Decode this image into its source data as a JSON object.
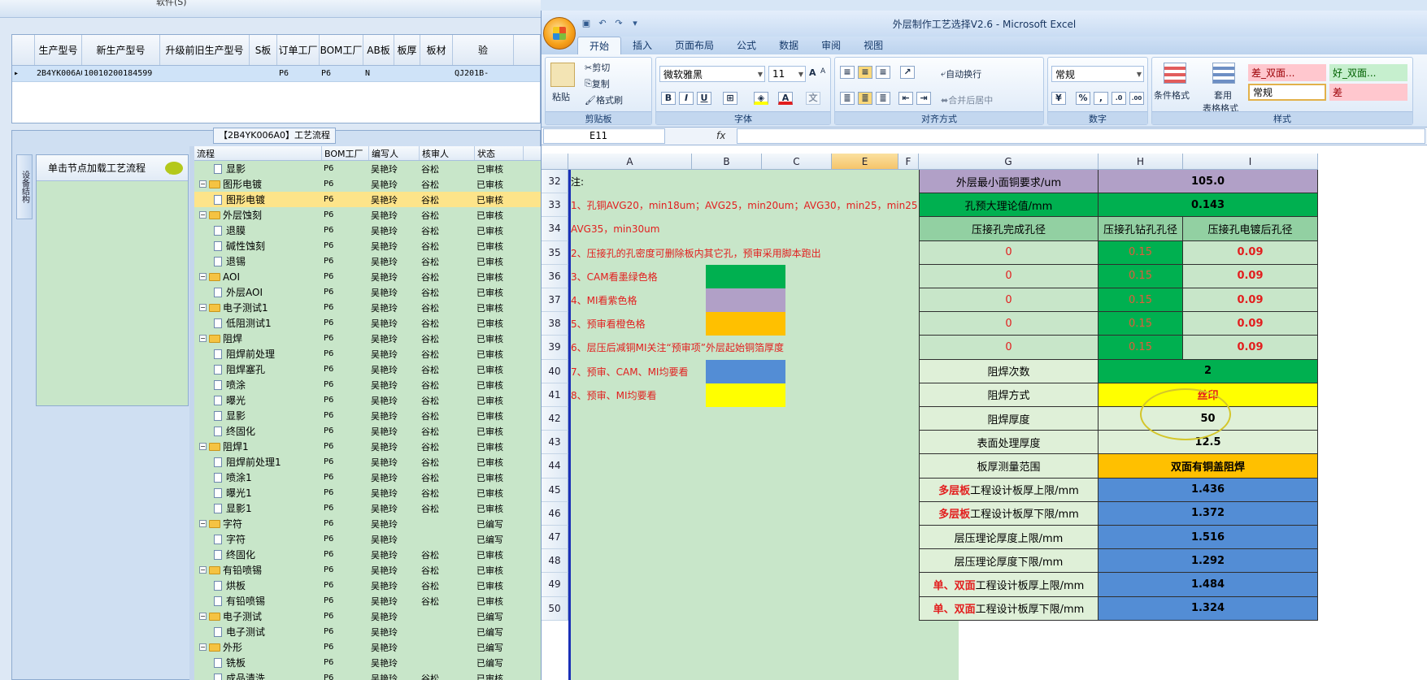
{
  "left_app": {
    "top_label": "软件(S)",
    "grid": {
      "columns": [
        "生产型号",
        "新生产型号",
        "升级前旧生产型号",
        "S板",
        "订单工厂",
        "BOM工厂",
        "AB板",
        "板厚",
        "板材",
        "验"
      ],
      "row": [
        "2B4YK006A0",
        "10010200184599",
        "",
        "",
        "P6",
        "P6",
        "N",
        "",
        "",
        "QJ201B-"
      ]
    },
    "flow_title": "【2B4YK006A0】工艺流程",
    "side_tab": "设备结构",
    "hint": "单击节点加载工艺流程",
    "tree_columns": [
      "流程",
      "BOM工厂",
      "编写人",
      "核审人",
      "状态"
    ],
    "tree_rows": [
      {
        "level": 2,
        "name": "显影",
        "bom": "P6",
        "writer": "吴艳玲",
        "reviewer": "谷松",
        "status": "已审核"
      },
      {
        "level": 1,
        "name": "图形电镀",
        "bom": "P6",
        "writer": "吴艳玲",
        "reviewer": "谷松",
        "status": "已审核"
      },
      {
        "level": 2,
        "name": "图形电镀",
        "bom": "P6",
        "writer": "吴艳玲",
        "reviewer": "谷松",
        "status": "已审核",
        "selected": true
      },
      {
        "level": 1,
        "name": "外层蚀刻",
        "bom": "P6",
        "writer": "吴艳玲",
        "reviewer": "谷松",
        "status": "已审核"
      },
      {
        "level": 2,
        "name": "退膜",
        "bom": "P6",
        "writer": "吴艳玲",
        "reviewer": "谷松",
        "status": "已审核"
      },
      {
        "level": 2,
        "name": "碱性蚀刻",
        "bom": "P6",
        "writer": "吴艳玲",
        "reviewer": "谷松",
        "status": "已审核"
      },
      {
        "level": 2,
        "name": "退锡",
        "bom": "P6",
        "writer": "吴艳玲",
        "reviewer": "谷松",
        "status": "已审核"
      },
      {
        "level": 1,
        "name": "AOI",
        "bom": "P6",
        "writer": "吴艳玲",
        "reviewer": "谷松",
        "status": "已审核"
      },
      {
        "level": 2,
        "name": "外层AOI",
        "bom": "P6",
        "writer": "吴艳玲",
        "reviewer": "谷松",
        "status": "已审核"
      },
      {
        "level": 1,
        "name": "电子测试1",
        "bom": "P6",
        "writer": "吴艳玲",
        "reviewer": "谷松",
        "status": "已审核"
      },
      {
        "level": 2,
        "name": "低阻测试1",
        "bom": "P6",
        "writer": "吴艳玲",
        "reviewer": "谷松",
        "status": "已审核"
      },
      {
        "level": 1,
        "name": "阻焊",
        "bom": "P6",
        "writer": "吴艳玲",
        "reviewer": "谷松",
        "status": "已审核"
      },
      {
        "level": 2,
        "name": "阻焊前处理",
        "bom": "P6",
        "writer": "吴艳玲",
        "reviewer": "谷松",
        "status": "已审核"
      },
      {
        "level": 2,
        "name": "阻焊塞孔",
        "bom": "P6",
        "writer": "吴艳玲",
        "reviewer": "谷松",
        "status": "已审核"
      },
      {
        "level": 2,
        "name": "喷涂",
        "bom": "P6",
        "writer": "吴艳玲",
        "reviewer": "谷松",
        "status": "已审核"
      },
      {
        "level": 2,
        "name": "曝光",
        "bom": "P6",
        "writer": "吴艳玲",
        "reviewer": "谷松",
        "status": "已审核"
      },
      {
        "level": 2,
        "name": "显影",
        "bom": "P6",
        "writer": "吴艳玲",
        "reviewer": "谷松",
        "status": "已审核"
      },
      {
        "level": 2,
        "name": "终固化",
        "bom": "P6",
        "writer": "吴艳玲",
        "reviewer": "谷松",
        "status": "已审核"
      },
      {
        "level": 1,
        "name": "阻焊1",
        "bom": "P6",
        "writer": "吴艳玲",
        "reviewer": "谷松",
        "status": "已审核"
      },
      {
        "level": 2,
        "name": "阻焊前处理1",
        "bom": "P6",
        "writer": "吴艳玲",
        "reviewer": "谷松",
        "status": "已审核"
      },
      {
        "level": 2,
        "name": "喷涂1",
        "bom": "P6",
        "writer": "吴艳玲",
        "reviewer": "谷松",
        "status": "已审核"
      },
      {
        "level": 2,
        "name": "曝光1",
        "bom": "P6",
        "writer": "吴艳玲",
        "reviewer": "谷松",
        "status": "已审核"
      },
      {
        "level": 2,
        "name": "显影1",
        "bom": "P6",
        "writer": "吴艳玲",
        "reviewer": "谷松",
        "status": "已审核"
      },
      {
        "level": 1,
        "name": "字符",
        "bom": "P6",
        "writer": "吴艳玲",
        "reviewer": "",
        "status": "已编写"
      },
      {
        "level": 2,
        "name": "字符",
        "bom": "P6",
        "writer": "吴艳玲",
        "reviewer": "",
        "status": "已编写"
      },
      {
        "level": 2,
        "name": "终固化",
        "bom": "P6",
        "writer": "吴艳玲",
        "reviewer": "谷松",
        "status": "已审核"
      },
      {
        "level": 1,
        "name": "有铅喷锡",
        "bom": "P6",
        "writer": "吴艳玲",
        "reviewer": "谷松",
        "status": "已审核"
      },
      {
        "level": 2,
        "name": "烘板",
        "bom": "P6",
        "writer": "吴艳玲",
        "reviewer": "谷松",
        "status": "已审核"
      },
      {
        "level": 2,
        "name": "有铅喷锡",
        "bom": "P6",
        "writer": "吴艳玲",
        "reviewer": "谷松",
        "status": "已审核"
      },
      {
        "level": 1,
        "name": "电子测试",
        "bom": "P6",
        "writer": "吴艳玲",
        "reviewer": "",
        "status": "已编写"
      },
      {
        "level": 2,
        "name": "电子测试",
        "bom": "P6",
        "writer": "吴艳玲",
        "reviewer": "",
        "status": "已编写"
      },
      {
        "level": 1,
        "name": "外形",
        "bom": "P6",
        "writer": "吴艳玲",
        "reviewer": "",
        "status": "已编写"
      },
      {
        "level": 2,
        "name": "铣板",
        "bom": "P6",
        "writer": "吴艳玲",
        "reviewer": "",
        "status": "已编写"
      },
      {
        "level": 2,
        "name": "成品清洗",
        "bom": "P6",
        "writer": "吴艳玲",
        "reviewer": "谷松",
        "status": "已审核"
      }
    ]
  },
  "excel": {
    "window_title": "外层制作工艺选择V2.6 - Microsoft Excel",
    "tabs": [
      "开始",
      "插入",
      "页面布局",
      "公式",
      "数据",
      "审阅",
      "视图"
    ],
    "active_tab": "开始",
    "clipboard": {
      "paste": "粘贴",
      "cut": "剪切",
      "copy": "复制",
      "format_painter": "格式刷",
      "label": "剪贴板"
    },
    "font": {
      "name": "微软雅黑",
      "size": "11",
      "label": "字体",
      "bold": "B",
      "italic": "I",
      "underline": "U",
      "grow": "A",
      "shrink": "A"
    },
    "alignment": {
      "wrap": "自动换行",
      "merge": "合并后居中",
      "label": "对齐方式"
    },
    "number": {
      "format": "常规",
      "percent": "%",
      "comma": ",",
      "inc": ".0",
      "dec": ".00",
      "label": "数字"
    },
    "styles": {
      "conditional": "条件格式",
      "table_line1": "套用",
      "table_line2": "表格格式",
      "label": "样式",
      "cells": [
        {
          "text": "差_双面...",
          "bg": "#ffc7ce",
          "fg": "#9c0006"
        },
        {
          "text": "好_双面...",
          "bg": "#c6efce",
          "fg": "#006100"
        },
        {
          "text": "常规",
          "bg": "#ffffff",
          "fg": "#000000"
        },
        {
          "text": "差",
          "bg": "#ffc7ce",
          "fg": "#9c0006"
        }
      ]
    },
    "name_box": "E11",
    "fx": "fx",
    "col_heads": [
      "A",
      "B",
      "C",
      "E",
      "F",
      "G",
      "H",
      "I"
    ],
    "row_nums": [
      "32",
      "33",
      "34",
      "35",
      "36",
      "37",
      "38",
      "39",
      "40",
      "41",
      "42",
      "43",
      "44",
      "45",
      "46",
      "47",
      "48",
      "49",
      "50"
    ],
    "notes": [
      {
        "text": "注:",
        "color": "#000000"
      },
      {
        "text": "1、孔铜AVG20，min18um；AVG25，min20um；AVG30，min25，min25",
        "color": "#e21e1e"
      },
      {
        "text": "AVG35，min30um",
        "color": "#e21e1e"
      },
      {
        "text": "2、压接孔的孔密度可删除板内其它孔，预审采用脚本跑出",
        "color": "#e21e1e"
      },
      {
        "text": "3、CAM看墨绿色格",
        "color": "#e21e1e",
        "swatch": "#00b050"
      },
      {
        "text": "4、MI看紫色格",
        "color": "#e21e1e",
        "swatch": "#b1a0c7"
      },
      {
        "text": "5、预审看橙色格",
        "color": "#e21e1e",
        "swatch": "#ffc000"
      },
      {
        "text": "6、层压后减铜MI关注“预审项”外层起始铜箔厚度",
        "color": "#e21e1e"
      },
      {
        "text": "7、预审、CAM、MI均要看",
        "color": "#e21e1e",
        "swatch": "#538dd5"
      },
      {
        "text": "8、预审、MI均要看",
        "color": "#e21e1e",
        "swatch": "#ffff00"
      }
    ],
    "right_table": [
      {
        "label": "外层最小面铜要求/um",
        "value": "105.0",
        "lbg": "#b1a0c7",
        "vbg": "#b1a0c7",
        "span": true
      },
      {
        "label": "孔预大理论值/mm",
        "value": "0.143",
        "lbg": "#00b050",
        "vbg": "#00b050",
        "span": true
      },
      {
        "label": "压接孔完成孔径",
        "h": "压接孔钻孔孔径",
        "i": "压接孔电镀后孔径",
        "lbg": "#92d0a2",
        "hbg": "#92d0a2",
        "ibg": "#92d0a2"
      },
      {
        "label": "0",
        "h": "0.15",
        "i": "0.09",
        "lbg": "#c8e6c9",
        "hbg": "#00b050",
        "ibg": "#c8e6c9",
        "red": true
      },
      {
        "label": "0",
        "h": "0.15",
        "i": "0.09",
        "lbg": "#c8e6c9",
        "hbg": "#00b050",
        "ibg": "#c8e6c9",
        "red": true
      },
      {
        "label": "0",
        "h": "0.15",
        "i": "0.09",
        "lbg": "#c8e6c9",
        "hbg": "#00b050",
        "ibg": "#c8e6c9",
        "red": true
      },
      {
        "label": "0",
        "h": "0.15",
        "i": "0.09",
        "lbg": "#c8e6c9",
        "hbg": "#00b050",
        "ibg": "#c8e6c9",
        "red": true
      },
      {
        "label": "0",
        "h": "0.15",
        "i": "0.09",
        "lbg": "#c8e6c9",
        "hbg": "#00b050",
        "ibg": "#c8e6c9",
        "red": true
      },
      {
        "label": "阻焊次数",
        "value": "2",
        "lbg": "#dff0d8",
        "vbg": "#00b050",
        "span": true
      },
      {
        "label": "阻焊方式",
        "value": "丝印",
        "lbg": "#dff0d8",
        "vbg": "#ffff00",
        "span": true,
        "vred": true
      },
      {
        "label": "阻焊厚度",
        "value": "50",
        "lbg": "#dff0d8",
        "vbg": "#dff0d8",
        "span": true
      },
      {
        "label": "表面处理厚度",
        "value": "12.5",
        "lbg": "#dff0d8",
        "vbg": "#dff0d8",
        "span": true
      },
      {
        "label": "板厚测量范围",
        "value": "双面有铜盖阻焊",
        "lbg": "#dff0d8",
        "vbg": "#ffc000",
        "span": true
      },
      {
        "label": "工程设计板厚上限/mm",
        "prefix": "多层板",
        "value": "1.436",
        "lbg": "#dff0d8",
        "vbg": "#538dd5",
        "span": true
      },
      {
        "label": "工程设计板厚下限/mm",
        "prefix": "多层板",
        "value": "1.372",
        "lbg": "#dff0d8",
        "vbg": "#538dd5",
        "span": true
      },
      {
        "label": "层压理论厚度上限/mm",
        "value": "1.516",
        "lbg": "#dff0d8",
        "vbg": "#538dd5",
        "span": true
      },
      {
        "label": "层压理论厚度下限/mm",
        "value": "1.292",
        "lbg": "#dff0d8",
        "vbg": "#538dd5",
        "span": true
      },
      {
        "label": "工程设计板厚上限/mm",
        "prefix": "单、双面",
        "value": "1.484",
        "lbg": "#dff0d8",
        "vbg": "#538dd5",
        "span": true
      },
      {
        "label": "工程设计板厚下限/mm",
        "prefix": "单、双面",
        "value": "1.324",
        "lbg": "#dff0d8",
        "vbg": "#538dd5",
        "span": true
      }
    ]
  }
}
